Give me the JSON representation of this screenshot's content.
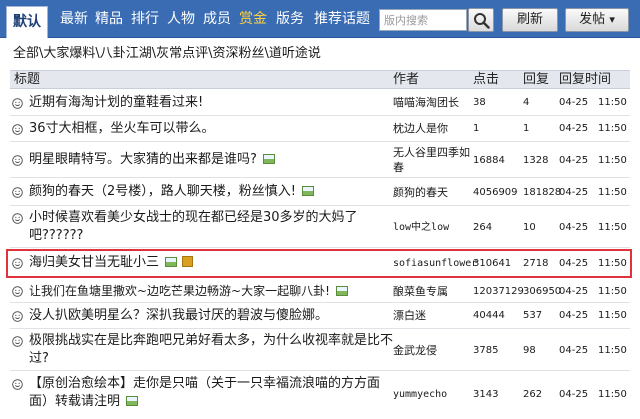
{
  "nav": {
    "tabs": [
      {
        "label": "默认",
        "active": true
      },
      {
        "label": "最新"
      },
      {
        "label": "精品"
      },
      {
        "label": "排行"
      },
      {
        "label": "人物"
      },
      {
        "label": "成员"
      },
      {
        "label": "赏金",
        "highlight_color": "#ffd23c"
      },
      {
        "label": "版务"
      },
      {
        "label": "推荐话题"
      }
    ],
    "search_placeholder": "版内搜索",
    "refresh_label": "刷新",
    "post_label": "发帖",
    "post_dropdown_glyph": "▾"
  },
  "breadcrumb": "全部\\大家爆料\\八卦江湖\\灰常点评\\资深粉丝\\道听途说",
  "table": {
    "headers": {
      "title": "标题",
      "author": "作者",
      "views": "点击",
      "replies": "回复",
      "time": "回复时间"
    },
    "rows": [
      {
        "title": "近期有海淘计划的童鞋看过来!",
        "author": "喵喵海淘团长",
        "views": "38",
        "replies": "4",
        "time": "04-25　11:50"
      },
      {
        "title": "36寸大相框，坐火车可以带么。",
        "author": "枕边人是你",
        "views": "1",
        "replies": "1",
        "time": "04-25　11:50"
      },
      {
        "title": "明星眼睛特写。大家猜的出来都是谁吗?",
        "author": "无人谷里四季如春",
        "views": "16884",
        "replies": "1328",
        "time": "04-25　11:50"
      },
      {
        "title": "颜狗的春天（2号楼），路人聊天楼，粉丝慎入!",
        "author": "颜狗的春天",
        "views": "4056909",
        "replies": "181828",
        "time": "04-25　11:50"
      },
      {
        "title": "小时候喜欢看美少女战士的现在都已经是30多岁的大妈了吧??????",
        "author": "low中之low",
        "views": "264",
        "replies": "10",
        "time": "04-25　11:50"
      },
      {
        "title": "海归美女甘当无耻小三",
        "author": "sofiasunflower",
        "views": "310641",
        "replies": "2718",
        "time": "04-25　11:50"
      },
      {
        "title": "让我们在鱼塘里撒欢~边吃芒果边畅游~大家一起聊八卦!",
        "author": "酿菜鱼专属",
        "views": "12037129",
        "replies": "306950",
        "time": "04-25　11:50"
      },
      {
        "title": "没人扒欧美明星么？深扒我最讨厌的碧波与傻脸娜。",
        "author": "漂白迷",
        "views": "40444",
        "replies": "537",
        "time": "04-25　11:50"
      },
      {
        "title": "极限挑战实在是比奔跑吧兄弟好看太多，为什么收视率就是比不过?",
        "author": "金武龙侵",
        "views": "3785",
        "replies": "98",
        "time": "04-25　11:50"
      },
      {
        "title": "【原创治愈绘本】走你是只喵（关于一只幸福流浪喵的方方面面）转载请注明",
        "author": "yummyecho",
        "views": "3143",
        "replies": "262",
        "time": "04-25　11:50"
      }
    ]
  },
  "colors": {
    "nav_bg": "#3a6cb4",
    "highlight_border": "#e0323a",
    "smiley": "#444444"
  }
}
